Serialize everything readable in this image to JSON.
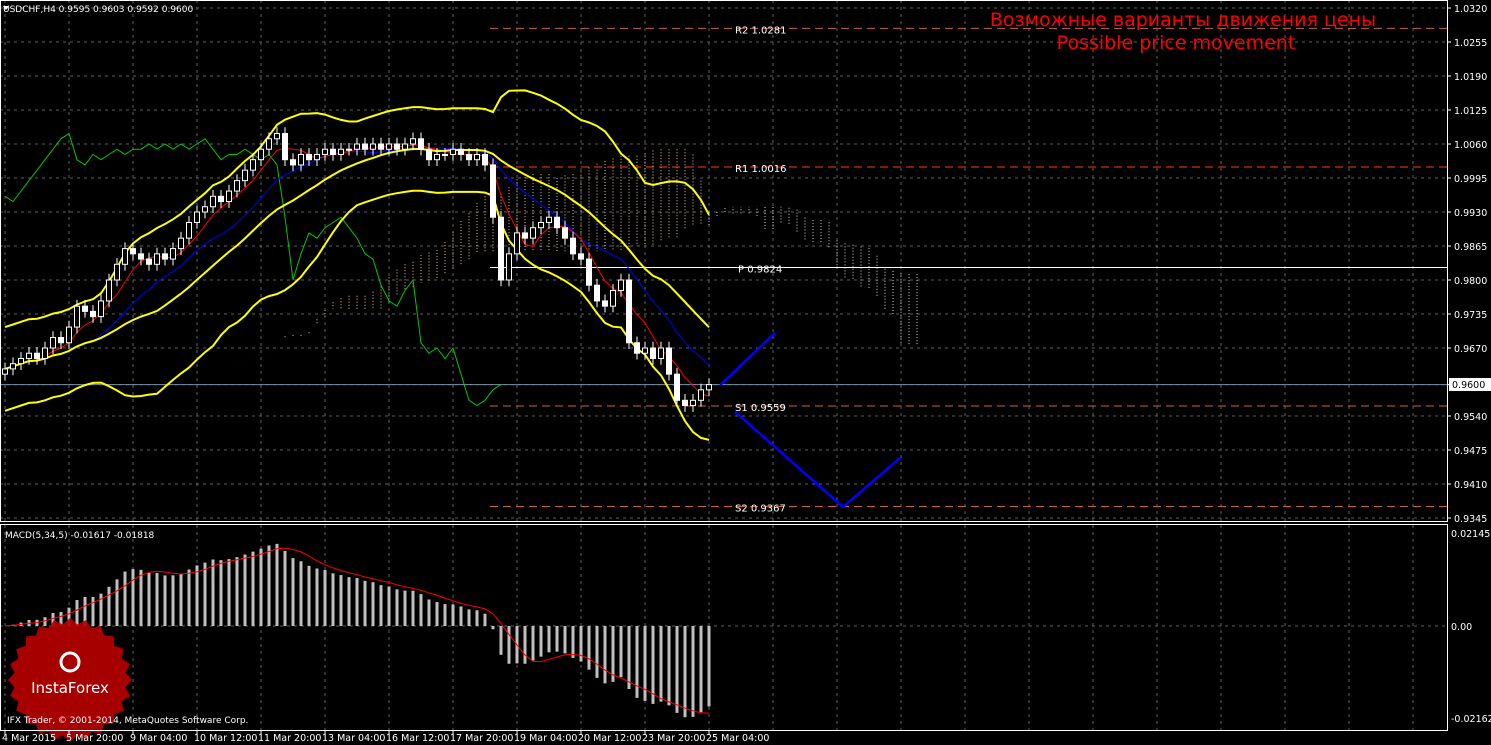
{
  "header": {
    "symbol_info": "USDCHF,H4  0.9595 0.9603 0.9592 0.9600"
  },
  "annotation": {
    "line1": "Возможные варианты движения цены",
    "line2": "Possible price movement",
    "color": "#ff0000"
  },
  "macd_label": "MACD(5,34,5) -0.01617 -0.01818",
  "copyright": "IFX Trader, © 2001-2014, MetaQuotes Software Corp.",
  "logo_text": "InstaForex",
  "current_price": "0.9600",
  "chart_data": {
    "type": "candlestick",
    "timeframe": "H4",
    "price_ticks": [
      "1.0320",
      "1.0255",
      "1.0190",
      "1.0125",
      "1.0060",
      "0.9995",
      "0.9930",
      "0.9865",
      "0.9800",
      "0.9735",
      "0.9670",
      "0.9600",
      "0.9540",
      "0.9475",
      "0.9410",
      "0.9345"
    ],
    "price_range": [
      0.9345,
      1.032
    ],
    "macd_ticks": [
      "0.02145",
      "0.00",
      "-0.02162"
    ],
    "macd_range": [
      -0.02162,
      0.02145
    ],
    "time_labels": [
      {
        "bar": 0,
        "label": "4 Mar 2015"
      },
      {
        "bar": 8,
        "label": "5 Mar 20:00"
      },
      {
        "bar": 16,
        "label": "9 Mar 04:00"
      },
      {
        "bar": 24,
        "label": "10 Mar 12:00"
      },
      {
        "bar": 32,
        "label": "11 Mar 20:00"
      },
      {
        "bar": 40,
        "label": "13 Mar 04:00"
      },
      {
        "bar": 48,
        "label": "16 Mar 12:00"
      },
      {
        "bar": 56,
        "label": "17 Mar 20:00"
      },
      {
        "bar": 64,
        "label": "19 Mar 04:00"
      },
      {
        "bar": 72,
        "label": "20 Mar 12:00"
      },
      {
        "bar": 80,
        "label": "23 Mar 20:00"
      },
      {
        "bar": 88,
        "label": "25 Mar 04:00"
      }
    ],
    "closes": [
      0.963,
      0.964,
      0.965,
      0.966,
      0.965,
      0.967,
      0.969,
      0.968,
      0.971,
      0.975,
      0.974,
      0.973,
      0.976,
      0.98,
      0.983,
      0.986,
      0.985,
      0.984,
      0.983,
      0.985,
      0.984,
      0.986,
      0.988,
      0.991,
      0.993,
      0.994,
      0.996,
      0.995,
      0.997,
      0.999,
      1.001,
      1.003,
      1.005,
      1.007,
      1.008,
      1.003,
      1.002,
      1.004,
      1.003,
      1.004,
      1.005,
      1.004,
      1.005,
      1.005,
      1.006,
      1.005,
      1.006,
      1.005,
      1.006,
      1.005,
      1.006,
      1.007,
      1.005,
      1.003,
      1.004,
      1.004,
      1.005,
      1.004,
      1.003,
      1.004,
      1.002,
      0.992,
      0.98,
      0.985,
      0.989,
      0.988,
      0.99,
      0.991,
      0.992,
      0.99,
      0.988,
      0.985,
      0.984,
      0.979,
      0.976,
      0.975,
      0.978,
      0.98,
      0.968,
      0.966,
      0.967,
      0.965,
      0.967,
      0.962,
      0.957,
      0.956,
      0.957,
      0.959,
      0.96
    ],
    "levels": [
      {
        "name": "R2",
        "label": "R2 1.0281",
        "price": 1.0281,
        "color": "#c8643c"
      },
      {
        "name": "R1",
        "label": "R1 1.0016",
        "price": 1.0016,
        "color": "#ff3c00"
      },
      {
        "name": "P",
        "label": "P 0.9824",
        "price": 0.9824,
        "color": "#ffffff"
      },
      {
        "name": "S1",
        "label": "S1 0.9559",
        "price": 0.9559,
        "color": "#c8643c"
      },
      {
        "name": "S2",
        "label": "S2 0.9367",
        "price": 0.9367,
        "color": "#c8643c"
      }
    ],
    "forecast_paths": [
      {
        "name": "bullish",
        "points": [
          [
            89.4,
            0.9599
          ],
          [
            96.25,
            0.9699
          ]
        ]
      },
      {
        "name": "bearish",
        "points": [
          [
            91.25,
            0.9548
          ],
          [
            104.75,
            0.9366
          ],
          [
            111.9,
            0.946
          ]
        ]
      }
    ],
    "colors": {
      "bollinger": "#ffff00",
      "ma_fast": "#ff0000",
      "ma_slow": "#0000ff",
      "chikou": "#00c800",
      "forecast": "#0000ff",
      "macd_signal": "#ff0000",
      "macd_hist": "#c0c0c0"
    }
  }
}
